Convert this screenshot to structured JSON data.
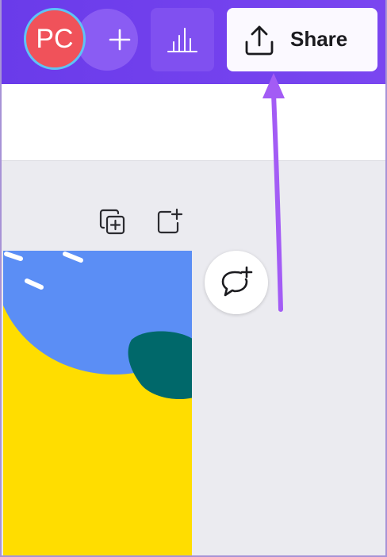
{
  "header": {
    "avatar_initials": "PC",
    "add_member_icon": "plus-icon",
    "insights_icon": "bar-chart-icon",
    "share_button": {
      "label": "Share",
      "icon": "upload-icon"
    }
  },
  "page_toolbar": {
    "duplicate_icon": "duplicate-page-icon",
    "add_page_icon": "add-page-icon"
  },
  "comment_button": {
    "icon": "add-comment-icon"
  },
  "annotation": {
    "type": "arrow",
    "color": "#a35cf5",
    "points_to": "share-button"
  },
  "colors": {
    "topbar": "#6a3bea",
    "avatar_bg": "#f0525a",
    "avatar_ring": "#5ec3f5",
    "canvas_bg": "#ebebf0",
    "design_yellow": "#ffdd00",
    "design_blue": "#5b8ef5",
    "design_teal": "#00686a"
  }
}
